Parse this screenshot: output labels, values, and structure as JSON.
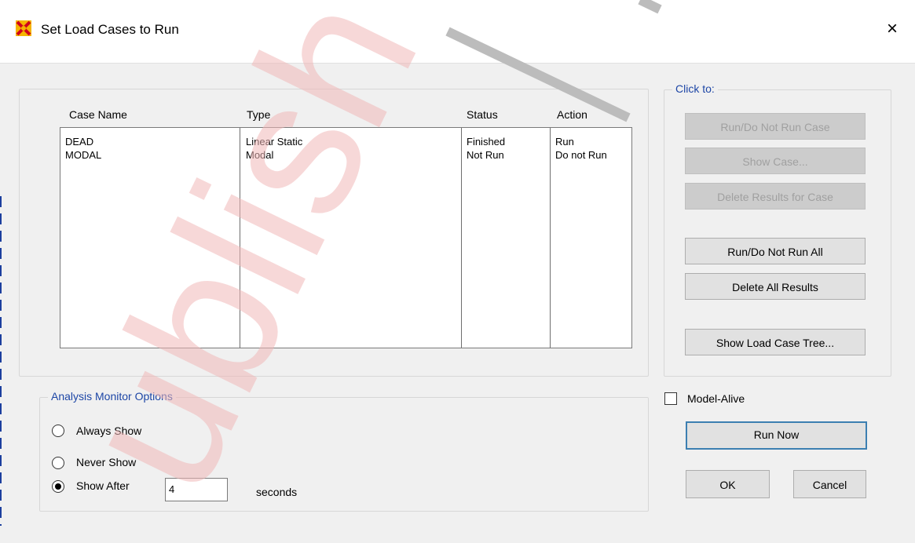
{
  "window": {
    "title": "Set Load Cases to Run",
    "close_glyph": "×",
    "icon": "sap-x-icon"
  },
  "cases_table": {
    "headers": [
      "Case Name",
      "Type",
      "Status",
      "Action"
    ],
    "rows": [
      {
        "case_name": "DEAD",
        "type": "Linear Static",
        "status": "Finished",
        "action": "Run"
      },
      {
        "case_name": "MODAL",
        "type": "Modal",
        "status": "Not Run",
        "action": "Do not Run"
      }
    ]
  },
  "click_to": {
    "title": "Click to:",
    "run_case": "Run/Do Not Run Case",
    "show_case": "Show Case...",
    "delete_results_case": "Delete Results for Case",
    "run_all": "Run/Do Not Run All",
    "delete_all": "Delete All Results",
    "show_tree": "Show Load Case Tree..."
  },
  "monitor": {
    "title": "Analysis Monitor Options",
    "always_show": "Always Show",
    "never_show": "Never Show",
    "show_after": "Show After",
    "seconds_value": "4",
    "seconds_label": "seconds",
    "selected": "Show After"
  },
  "model_alive": {
    "label": "Model-Alive",
    "checked": false
  },
  "actions": {
    "run_now": "Run Now",
    "ok": "OK",
    "cancel": "Cancel"
  },
  "watermark": {
    "text": "ublish",
    "color": "#f0b8b8"
  }
}
